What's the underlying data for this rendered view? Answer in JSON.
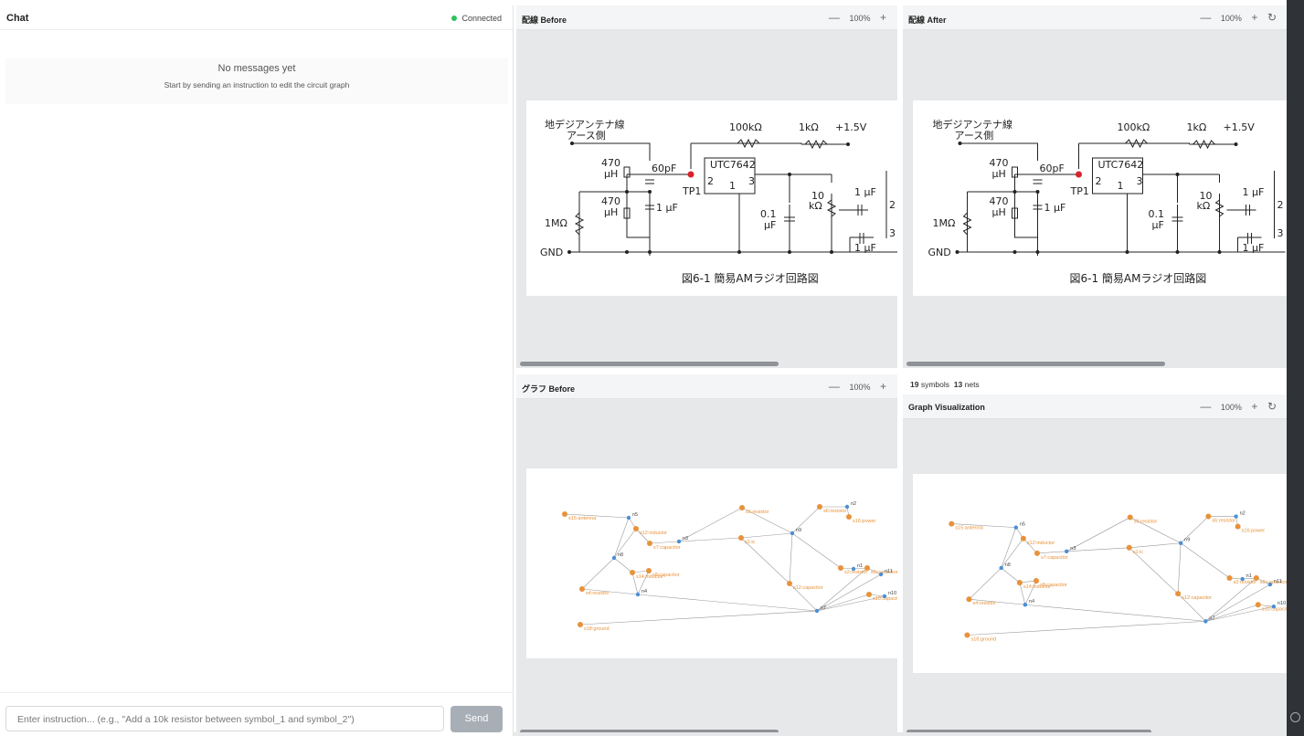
{
  "chat": {
    "title": "Chat",
    "status": "Connected",
    "empty_title": "No messages yet",
    "empty_subtitle": "Start by sending an instruction to edit the circuit graph",
    "input_placeholder": "Enter instruction... (e.g., \"Add a 10k resistor between symbol_1 and symbol_2\")",
    "send_label": "Send"
  },
  "panels": {
    "wiring_before": {
      "title": "配線 Before",
      "zoom": "100%"
    },
    "wiring_after": {
      "title": "配線 After",
      "zoom": "100%"
    },
    "graph_before": {
      "title": "グラフ Before",
      "zoom": "100%"
    },
    "graph_after": {
      "title": "Graph Visualization",
      "zoom": "100%"
    }
  },
  "stats": {
    "symbols_count": "19",
    "symbols_label": "symbols",
    "nets_count": "13",
    "nets_label": "nets"
  },
  "controls": {
    "minus": "—",
    "plus": "+",
    "reset": "↻"
  },
  "schematic": {
    "antenna": "地デジアンテナ線",
    "antenna2": "アース側",
    "r100k": "100kΩ",
    "r1k": "1kΩ",
    "vplus": "+1.5V",
    "ic": "UTC7642",
    "l470a": "470",
    "l470a_u": "μH",
    "l470b": "470",
    "l470b_u": "μH",
    "c60p": "60pF",
    "c1u": "1 μF",
    "tp1": "TP1",
    "pin2": "2",
    "pin1": "1",
    "pin3": "3",
    "r1m": "1MΩ",
    "c01": "0.1",
    "c01_u": "μF",
    "vr10k": "10",
    "vr10k_u": "kΩ",
    "c1u_r1": "1 μF",
    "c1u_r2": "1 μF",
    "gnd": "GND",
    "caption": "図6-1  簡易AMラジオ回路図",
    "edge2": "2",
    "edge3": "3"
  },
  "graph": {
    "nodes": {
      "s15": "s15:antenna",
      "n5": "n5",
      "s12": "s12:inductor",
      "n8": "n8",
      "s7": "s7:capacitor",
      "n3": "n3",
      "s5": "s5:resistor",
      "s6": "s6:resistor",
      "n2": "n2",
      "s16": "s16:power",
      "n9": "n9",
      "s1": "s1:ic",
      "s14": "s14:inductor",
      "s8": "s8:capacitor",
      "s4": "s4:resistor",
      "n4": "n4",
      "s12b": "s12:capacitor",
      "s2": "s2:resistor",
      "n1": "n1",
      "s9": "s9:capacitor",
      "n11": "n11",
      "s10": "s10:capacitor",
      "n10": "n10",
      "n7": "n7",
      "s18": "s18:ground"
    }
  },
  "colors": {
    "accent_dot": "#2ec05c",
    "symbol_node": "#e8923a",
    "net_node": "#4b8fd6",
    "edge": "#999999"
  }
}
